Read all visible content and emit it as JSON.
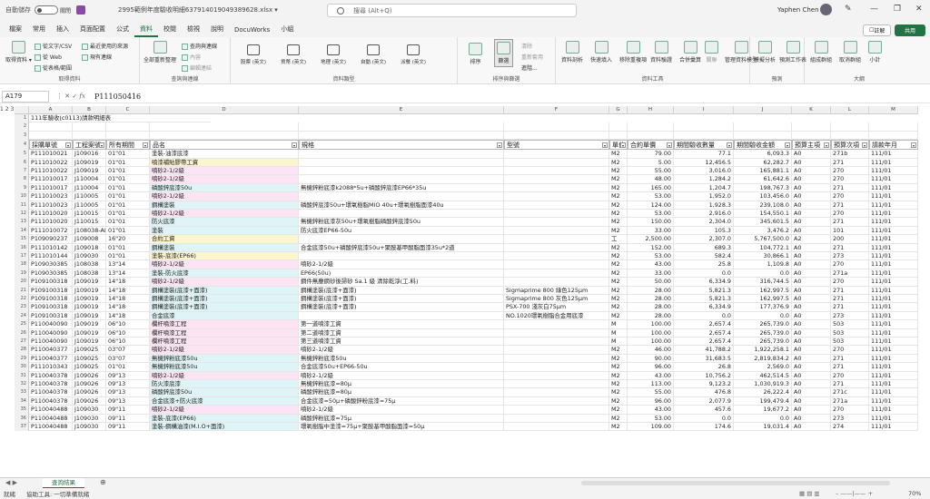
{
  "title": {
    "autosave": "自動儲存",
    "toggle": "關閉",
    "filename": "2995範例年度驗收明細637914019049389628.xlsx ▾",
    "search_placeholder": "搜尋 (Alt+Q)",
    "user": "Yaphen Chen"
  },
  "tabs": [
    "檔案",
    "常用",
    "插入",
    "頁面配置",
    "公式",
    "資料",
    "校閱",
    "檢視",
    "說明",
    "DocuWorks",
    "小組"
  ],
  "active_tab": "資料",
  "comment_label": "註解",
  "share_label": "共用",
  "ribbon": {
    "get_data": {
      "label": "取得資料",
      "big": "取得資料 ▾",
      "items": [
        "從文字/CSV",
        "從 Web",
        "從表格/範圍",
        "最近使用的來源",
        "現有連線"
      ]
    },
    "queries": {
      "label": "查詢與連線",
      "big": "全部重新整理",
      "items": [
        "查詢與連線",
        "內容",
        "編輯連結"
      ]
    },
    "data_types": {
      "label": "資料類型",
      "items": [
        "股票 (英文)",
        "貨幣 (英文)",
        "地理 (英文)",
        "自動 (英文)",
        "派餐 (英文)"
      ]
    },
    "sort_filter": {
      "label": "排序與篩選",
      "items": [
        "排序",
        "篩選",
        "清除",
        "重新套用",
        "進階..."
      ]
    },
    "tools": {
      "label": "資料工具",
      "items": [
        "資料剖析",
        "快速填入",
        "移除重複項",
        "資料驗證",
        "合併彙算",
        "關聯",
        "管理資料模型"
      ]
    },
    "forecast": {
      "label": "預測",
      "items": [
        "模擬分析",
        "預測工作表"
      ]
    },
    "outline": {
      "label": "大綱",
      "items": [
        "組成群組",
        "取消群組",
        "小計"
      ]
    }
  },
  "formula_bar": {
    "namebox": "A179",
    "formula": "P111050416"
  },
  "top_rows": {
    "r1": "111年驗收(c0113)請款明細表"
  },
  "columns": [
    "A",
    "B",
    "C",
    "D",
    "E",
    "F",
    "G",
    "H",
    "I",
    "J",
    "K",
    "L",
    "M"
  ],
  "headers": [
    "採購單號",
    "工程案號",
    "所有期間",
    "品名",
    "規格",
    "型號",
    "單位",
    "合約單價",
    "期間驗收數量",
    "期間驗收金額",
    "預算主項",
    "預算次項",
    "請款年月"
  ],
  "rows": [
    [
      "P111010021",
      "J109016",
      "01\"01",
      "塗裝-油漆底漆",
      "",
      "",
      "M2",
      "79.00",
      "77.1",
      "6,093.3",
      "A0",
      "271b",
      "111/01",
      "#ffffff"
    ],
    [
      "P111010022",
      "J109019",
      "01\"01",
      "噴漆補貼膠帶工資",
      "",
      "",
      "M2",
      "5.00",
      "12,456.5",
      "62,282.7",
      "A0",
      "271",
      "111/01",
      "#fdf5ce"
    ],
    [
      "P111010022",
      "J109019",
      "01\"01",
      "噴砂2-1/2級",
      "",
      "",
      "M2",
      "55.00",
      "3,016.0",
      "165,881.1",
      "A0",
      "270",
      "111/01",
      "#fce4f4"
    ],
    [
      "P111010017",
      "J110004",
      "01\"01",
      "噴砂2-1/2級",
      "",
      "",
      "M2",
      "48.00",
      "1,284.2",
      "61,642.6",
      "A0",
      "270",
      "111/01",
      "#fce4f4"
    ],
    [
      "P111010017",
      "J110004",
      "01\"01",
      "磷酸鋅底漆50u",
      "無機鋅粉底漆k2088*5u+磷酸鋅底漆EP66*35u",
      "",
      "M2",
      "165.00",
      "1,204.7",
      "198,767.3",
      "A0",
      "271",
      "111/01",
      "#dff4f7"
    ],
    [
      "P111010023",
      "J110005",
      "01\"01",
      "噴砂2-1/2級",
      "",
      "",
      "M2",
      "53.00",
      "1,952.0",
      "103,456.0",
      "A0",
      "270",
      "111/01",
      "#fce4f4"
    ],
    [
      "P111010023",
      "J110005",
      "01\"01",
      "鋼構塗裝",
      "磷酸鋅底漆50u+環氧樹脂MIO 40u+環氧樹脂面漆40u",
      "",
      "M2",
      "124.00",
      "1,928.3",
      "239,108.0",
      "A0",
      "271",
      "111/01",
      "#dff4f7"
    ],
    [
      "P111010020",
      "J110015",
      "01\"01",
      "噴砂2-1/2級",
      "",
      "",
      "M2",
      "53.00",
      "2,916.0",
      "154,550.1",
      "A0",
      "270",
      "111/01",
      "#fce4f4"
    ],
    [
      "P111010020",
      "J110015",
      "01\"01",
      "防火底漆",
      "無機鋅粉底漆灰50u+環氧樹脂磷酸鋅底漆50u",
      "",
      "M2",
      "150.00",
      "2,304.0",
      "345,601.5",
      "A0",
      "271",
      "111/01",
      "#dff4f7"
    ],
    [
      "P111010072",
      "J108038-AD",
      "01\"01",
      "塗裝",
      "防火底漆EP66-50u",
      "",
      "M2",
      "33.00",
      "105.3",
      "3,476.2",
      "A0",
      "101",
      "111/01",
      "#dff4f7"
    ],
    [
      "P109090237",
      "J109008",
      "16\"20",
      "合約工資",
      "",
      "",
      "工",
      "2,500.00",
      "2,307.0",
      "5,767,500.0",
      "A2",
      "200",
      "111/01",
      "#fdf5ce"
    ],
    [
      "P111010142",
      "J109018",
      "01\"01",
      "鋼構塗裝",
      "合金底漆50u+磷酸鋅底漆50u+聚胺基甲酸脂面漆35u*2道",
      "",
      "M2",
      "152.00",
      "689.3",
      "104,772.1",
      "A0",
      "271",
      "111/01",
      "#dff4f7"
    ],
    [
      "P111010144",
      "J109030",
      "01\"01",
      "塗裝-底漆(EP66)",
      "",
      "",
      "M2",
      "53.00",
      "582.4",
      "30,866.1",
      "A0",
      "273",
      "111/01",
      "#fdf5ce"
    ],
    [
      "P109030385",
      "J108038",
      "13\"14",
      "噴砂2-1/2級",
      "噴砂2-1/2級",
      "",
      "M2",
      "43.00",
      "25.8",
      "1,109.8",
      "A0",
      "270",
      "111/01",
      "#fce4f4"
    ],
    [
      "P109030385",
      "J108038",
      "13\"14",
      "塗裝-防火底漆",
      "EP66(50u)",
      "",
      "M2",
      "33.00",
      "0.0",
      "0.0",
      "A0",
      "271a",
      "111/01",
      "#dff4f7"
    ],
    [
      "P109100318",
      "J109019",
      "14\"18",
      "噴砂2-1/2級",
      "鋼件無塵鋼砂後掃砂 Sa.1 級 清除乾淨(工.料)",
      "",
      "M2",
      "50.00",
      "6,334.9",
      "316,744.5",
      "A0",
      "270",
      "111/01",
      "#fce4f4"
    ],
    [
      "P109100318",
      "J109019",
      "14\"18",
      "鋼構塗裝(底漆+面漆)",
      "鋼構塗裝(底漆+面漆)",
      "Sigmaprime 800 綠色125μm",
      "M2",
      "28.00",
      "5,821.3",
      "162,997.5",
      "A0",
      "271",
      "111/01",
      "#dff4f7"
    ],
    [
      "P109100318",
      "J109019",
      "14\"18",
      "鋼構塗裝(底漆+面漆)",
      "鋼構塗裝(底漆+面漆)",
      "Sigmaprime 800 灰色125μm",
      "M2",
      "28.00",
      "5,821.3",
      "162,997.5",
      "A0",
      "271",
      "111/01",
      "#dff4f7"
    ],
    [
      "P109100318",
      "J109019",
      "14\"18",
      "鋼構塗裝(底漆+面漆)",
      "鋼構塗裝(底漆+面漆)",
      "PSX-700 淺灰白75μm",
      "M2",
      "28.00",
      "6,334.9",
      "177,376.9",
      "A0",
      "271",
      "111/01",
      "#dff4f7"
    ],
    [
      "P109100318",
      "J109019",
      "14\"18",
      "合金底漆",
      "",
      "NO.1020環氧樹脂合金用底漆",
      "M2",
      "28.00",
      "0.0",
      "0.0",
      "A0",
      "273",
      "111/01",
      "#dff4f7"
    ],
    [
      "P110040090",
      "J109019",
      "06\"10",
      "欄杆噴漆工程",
      "第一道噴漆工資",
      "",
      "M",
      "100.00",
      "2,657.4",
      "265,739.0",
      "A0",
      "503",
      "111/01",
      "#fce4f4"
    ],
    [
      "P110040090",
      "J109019",
      "06\"10",
      "欄杆噴漆工程",
      "第二道噴漆工資",
      "",
      "M",
      "100.00",
      "2,657.4",
      "265,739.0",
      "A0",
      "503",
      "111/01",
      "#fce4f4"
    ],
    [
      "P110040090",
      "J109019",
      "06\"10",
      "欄杆噴漆工程",
      "第三道噴漆工資",
      "",
      "M",
      "100.00",
      "2,657.4",
      "265,739.0",
      "A0",
      "503",
      "111/01",
      "#fce4f4"
    ],
    [
      "P110040377",
      "J109025",
      "03\"07",
      "噴砂2-1/2級",
      "噴砂2-1/2級",
      "",
      "M2",
      "46.00",
      "41,788.2",
      "1,922,258.1",
      "A0",
      "270",
      "111/01",
      "#fce4f4"
    ],
    [
      "P110040377",
      "J109025",
      "03\"07",
      "無機鋅粉底漆50u",
      "無機鋅粉底漆50u",
      "",
      "M2",
      "90.00",
      "31,683.5",
      "2,819,834.2",
      "A0",
      "271",
      "111/01",
      "#dff4f7"
    ],
    [
      "P111010343",
      "J109025",
      "01\"01",
      "無機鋅粉底漆50u",
      "合金底漆50u+EP66-50u",
      "",
      "M2",
      "96.00",
      "26.8",
      "2,569.0",
      "A0",
      "271",
      "111/01",
      "#dff4f7"
    ],
    [
      "P110040378",
      "J109026",
      "09\"13",
      "噴砂2-1/2級",
      "噴砂2-1/2級",
      "",
      "M2",
      "43.00",
      "10,756.2",
      "462,514.5",
      "A0",
      "270",
      "111/01",
      "#fce4f4"
    ],
    [
      "P110040378",
      "J109026",
      "09\"13",
      "防火漆底漆",
      "無機鋅粉底漆=80μ",
      "",
      "M2",
      "113.00",
      "9,123.2",
      "1,030,919.3",
      "A0",
      "271",
      "111/01",
      "#dff4f7"
    ],
    [
      "P110040378",
      "J109026",
      "09\"13",
      "磷酸鋅底漆50u",
      "磷酸鋅粉底漆=80μ",
      "",
      "M2",
      "55.00",
      "476.8",
      "26,222.4",
      "A0",
      "271c",
      "111/01",
      "#dff4f7"
    ],
    [
      "P110040378",
      "J109026",
      "09\"13",
      "合金底漆+防火底漆",
      "合金底漆=50μ+磷酸鋅粉底漆=75μ",
      "",
      "M2",
      "96.00",
      "2,077.9",
      "199,479.4",
      "A0",
      "271a",
      "111/01",
      "#dff4f7"
    ],
    [
      "P110040488",
      "J109030",
      "09\"11",
      "噴砂2-1/2級",
      "噴砂2-1/2級",
      "",
      "M2",
      "43.00",
      "457.6",
      "19,677.2",
      "A0",
      "270",
      "111/01",
      "#fce4f4"
    ],
    [
      "P110040488",
      "J109030",
      "09\"11",
      "塗裝-底漆(EP66)",
      "磷酸鋅粉底漆=75μ",
      "",
      "M2",
      "53.00",
      "0.0",
      "0.0",
      "A0",
      "273",
      "111/01",
      "#dff4f7"
    ],
    [
      "P110040488",
      "J109030",
      "09\"11",
      "塗裝-鋼構油漆(M.I.O+面漆)",
      "環氧樹脂中塗漆=75μ+聚胺基甲酸脂面漆=50μ",
      "",
      "M2",
      "109.00",
      "174.6",
      "19,031.4",
      "A0",
      "274",
      "111/01",
      "#dff4f7"
    ]
  ],
  "sheet_tab": "查詢結果",
  "status": {
    "ready": "就緒",
    "accessibility": "協助工具: 一切準備就緒",
    "zoom": "70%"
  }
}
